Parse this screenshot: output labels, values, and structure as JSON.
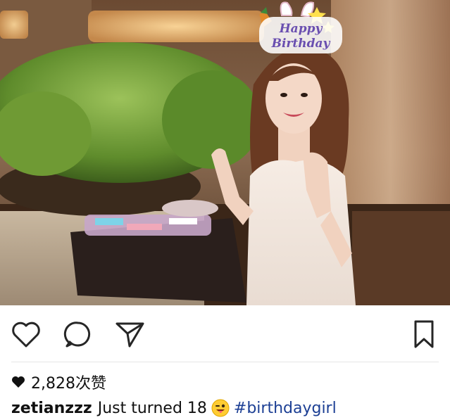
{
  "photo": {
    "crown_text": "Happy Birthday"
  },
  "actions": {
    "like_icon": "heart-outline-icon",
    "comment_icon": "comment-bubble-icon",
    "share_icon": "paper-plane-icon",
    "save_icon": "bookmark-icon"
  },
  "likes": {
    "icon": "heart-filled-icon",
    "text": "2,828次赞"
  },
  "caption": {
    "username": "zetianzzz",
    "text": "Just turned 18",
    "emoji": "winking-tongue-face",
    "hashtag": "#birthdaygirl"
  },
  "colors": {
    "hashtag": "#1c3f94",
    "icon_stroke": "#262626"
  }
}
